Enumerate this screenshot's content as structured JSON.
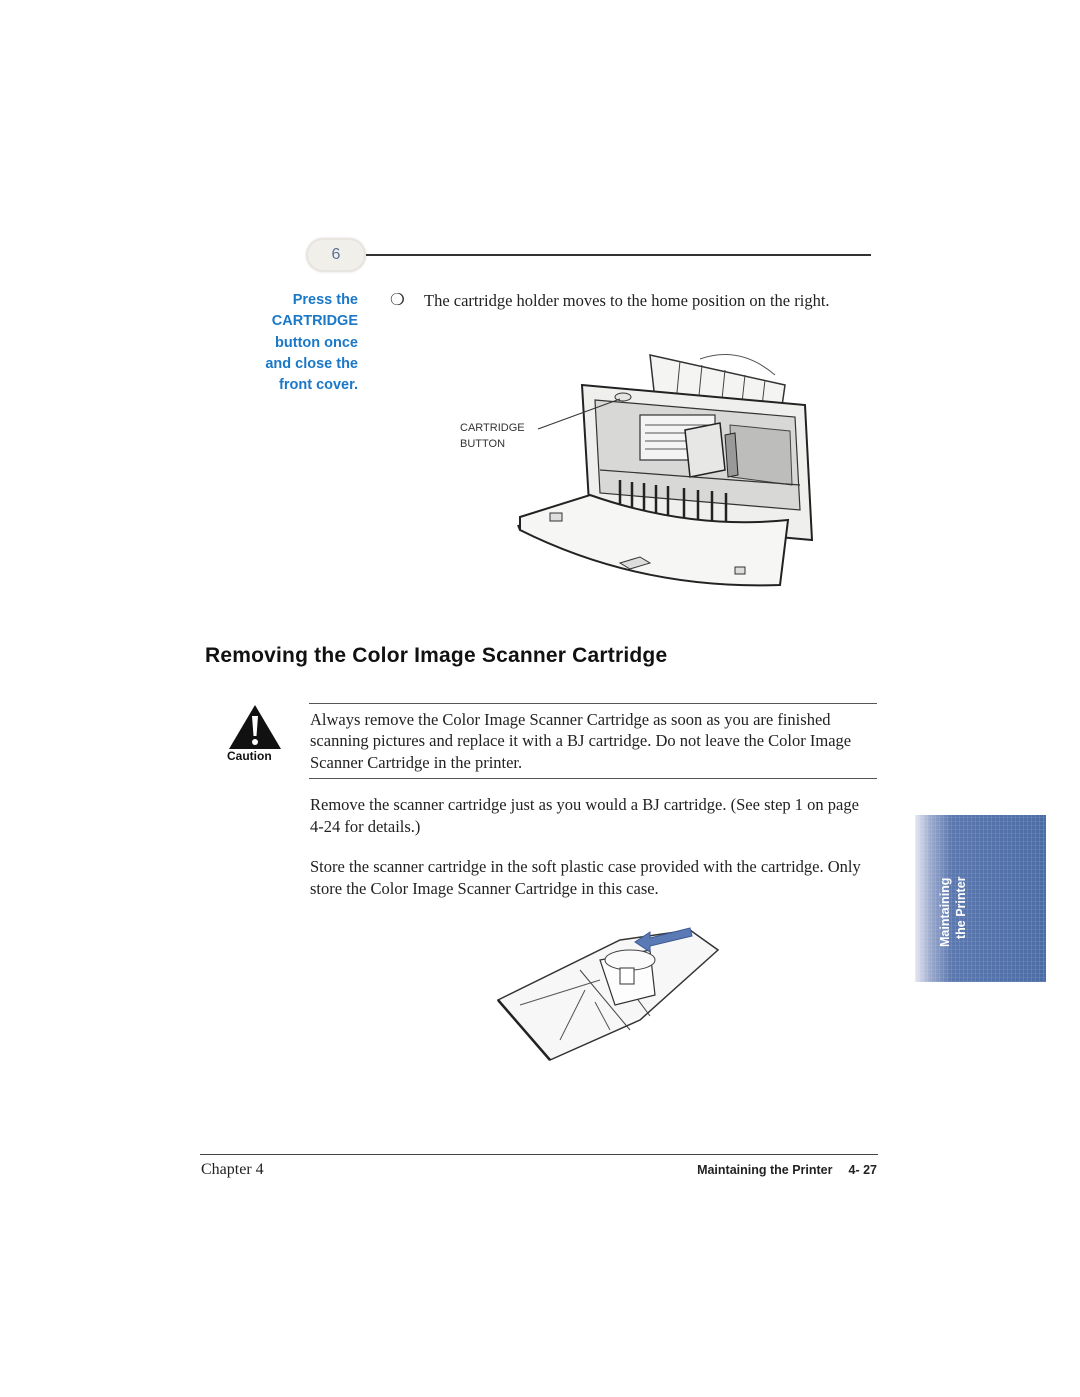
{
  "step": {
    "number": "6"
  },
  "side_note": {
    "lines": [
      "Press the",
      "CARTRIDGE",
      "button once",
      "and close the",
      "front cover."
    ],
    "color": "#1a78c8"
  },
  "step_bullet": {
    "glyph": "❍",
    "text": "The cartridge holder moves to the home position on the right."
  },
  "printer_figure": {
    "callout_lines": [
      "CARTRIDGE",
      "BUTTON"
    ]
  },
  "section": {
    "title": "Removing the Color Image Scanner Cartridge"
  },
  "caution": {
    "icon": "warning-triangle-icon",
    "label": "Caution",
    "text": "Always remove the Color Image Scanner Cartridge as soon as you are finished scanning pictures and replace it with a BJ cartridge. Do not leave the Color Image Scanner Cartridge in the printer."
  },
  "paragraphs": [
    "Remove the scanner cartridge just as you would a BJ cartridge. (See step 1 on page 4-24 for details.)",
    "Store the scanner cartridge in the soft plastic case provided with the cartridge. Only store the Color Image Scanner Cartridge in this case."
  ],
  "side_tab": {
    "lines": [
      "Maintaining",
      "the Printer"
    ],
    "color": "#4c6ca6"
  },
  "footer": {
    "chapter": "Chapter 4",
    "section": "Maintaining the Printer",
    "page": "4- 27"
  }
}
